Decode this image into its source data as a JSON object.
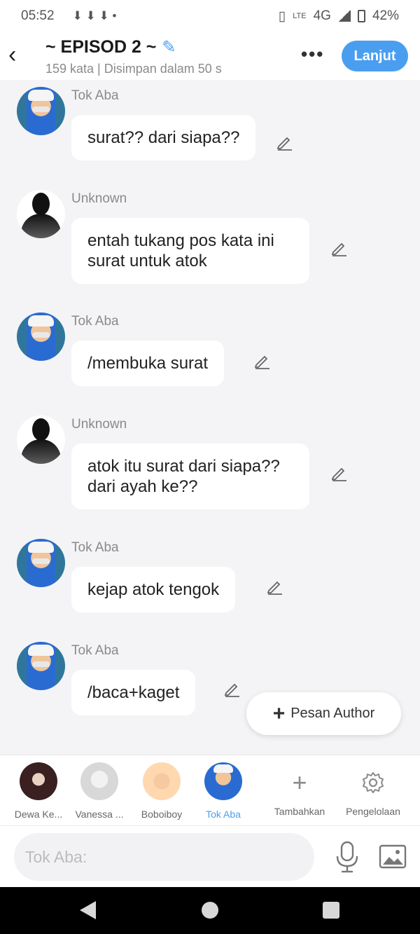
{
  "status_bar": {
    "time": "05:52",
    "downloads": "⬇ ⬇ ⬇ •",
    "network": "4G",
    "volte": "LTE",
    "battery": "42%"
  },
  "header": {
    "back_icon": "back-arrow-icon",
    "title": "~ EPISOD 2 ~",
    "subtitle": "159 kata | Disimpan dalam 50 s",
    "more_label": "•••",
    "next_label": "Lanjut"
  },
  "messages": [
    {
      "sender": "Tok Aba",
      "avatar": "tok",
      "text": "surat?? dari siapa??"
    },
    {
      "sender": "Unknown",
      "avatar": "unknown",
      "text": "entah tukang pos kata ini surat untuk atok"
    },
    {
      "sender": "Tok Aba",
      "avatar": "tok",
      "text": "/membuka surat"
    },
    {
      "sender": "Unknown",
      "avatar": "unknown",
      "text": "atok itu surat dari siapa?? dari ayah ke??"
    },
    {
      "sender": "Tok Aba",
      "avatar": "tok",
      "text": "kejap atok tengok"
    },
    {
      "sender": "Tok Aba",
      "avatar": "tok",
      "text": "/baca+kaget"
    }
  ],
  "floating_button": {
    "plus": "+",
    "label": "Pesan Author"
  },
  "characters": [
    {
      "label": "Dewa Ke...",
      "active": false
    },
    {
      "label": "Vanessa ...",
      "active": false
    },
    {
      "label": "Boboiboy",
      "active": false
    },
    {
      "label": "Tok Aba",
      "active": true
    }
  ],
  "tools": {
    "add": {
      "icon": "plus-icon",
      "glyph": "+",
      "label": "Tambahkan"
    },
    "manage": {
      "icon": "gear-icon",
      "label": "Pengelolaan"
    }
  },
  "composer": {
    "placeholder": "Tok Aba:",
    "mic_icon": "microphone-icon",
    "image_icon": "image-icon"
  },
  "colors": {
    "accent": "#4a9ef0",
    "background": "#f4f4f6",
    "bubble": "#ffffff",
    "muted_text": "#8a8a8a"
  }
}
